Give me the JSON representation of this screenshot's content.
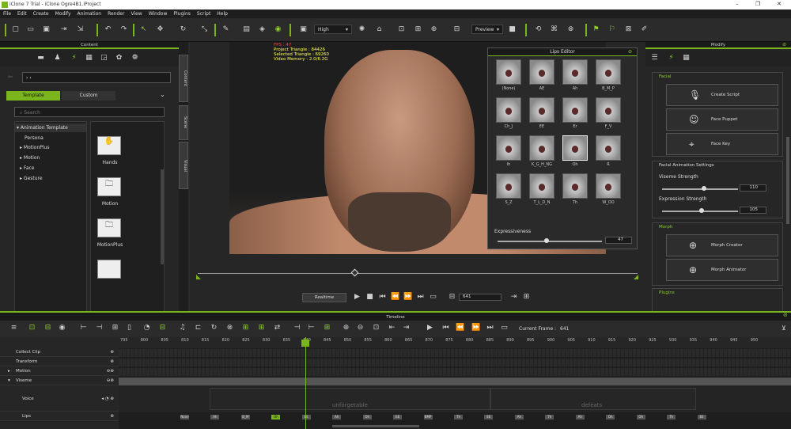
{
  "window": {
    "title": "iClone 7 Trial - iClone Ogre4B1.iProject",
    "controls": [
      "–",
      "❐",
      "✕"
    ]
  },
  "menu": [
    "File",
    "Edit",
    "Create",
    "Modify",
    "Animation",
    "Render",
    "View",
    "Window",
    "Plugins",
    "Script",
    "Help"
  ],
  "toolbar": {
    "quality": "High",
    "view_mode": "Preview",
    "icons": [
      "select-icon",
      "open-icon",
      "save-icon",
      "export-icon",
      "export2-icon",
      "undo-icon",
      "redo-icon",
      "pointer-icon",
      "move-icon",
      "rotate-icon",
      "scale-icon",
      "brush-icon",
      "display-icon",
      "light-icon",
      "quality-icon",
      "sun-icon",
      "home-icon",
      "align-icon",
      "fit-icon",
      "snap-icon",
      "camera-icon",
      "ik-icon",
      "fk-icon",
      "link-icon",
      "motion-icon",
      "flag-icon",
      "flag2-icon",
      "picker-icon"
    ]
  },
  "content_panel": {
    "title": "Content",
    "tabs": [
      "Template",
      "Custom"
    ],
    "search_placeholder": "Search",
    "path": "› ›",
    "tree": [
      "▾ Animation Template",
      "Persona",
      "▸ MotionPlus",
      "▸ Motion",
      "▸ Face",
      "▸ Gesture"
    ],
    "items": [
      "Hands",
      "Motion",
      "MotionPlus",
      ""
    ],
    "side_tabs": [
      "Content",
      "Scene",
      "Visual"
    ]
  },
  "viewport": {
    "stats": [
      "FPS : 47",
      "Project Triangle : 84426",
      "Selected Triangle : 69260",
      "Video Memory : 2.0/6.2G"
    ]
  },
  "lips_editor": {
    "title": "Lips Editor",
    "visemes": [
      "(None)",
      "AE",
      "Ah",
      "B_M_P",
      "Ch_J",
      "EE",
      "Er",
      "F_V",
      "Ih",
      "K_G_H_NG",
      "Oh",
      "R",
      "S_Z",
      "T_L_D_N",
      "Th",
      "W_OO"
    ],
    "selected": "Oh",
    "expressiveness_label": "Expressiveness",
    "expressiveness": "47",
    "expressiveness_fraction": 0.47
  },
  "playback": {
    "mode": "Realtime",
    "frame": "641",
    "loop_icon": "loop-icon"
  },
  "modify_panel": {
    "title": "Modify",
    "facial_label": "Facial",
    "buttons": [
      "Create Script",
      "Face Puppet",
      "Face Key"
    ],
    "settings_label": "Facial Animation Settings",
    "viseme_strength_label": "Viseme Strength",
    "viseme_strength": "110",
    "viseme_strength_fraction": 0.55,
    "expression_strength_label": "Expression Strength",
    "expression_strength": "105",
    "expression_strength_fraction": 0.52,
    "morph_label": "Morph",
    "morph_buttons": [
      "Morph Creator",
      "Morph Animator"
    ],
    "plugins_label": "Plugins"
  },
  "timeline": {
    "title": "Timeline",
    "current_frame_label": "Current Frame :",
    "current_frame": "641",
    "rows": [
      "Collect Clip",
      "Transform",
      "Motion",
      "Viseme",
      "Voice",
      "Lips"
    ],
    "ticks": [
      "795",
      "800",
      "805",
      "810",
      "815",
      "820",
      "825",
      "830",
      "835",
      "840",
      "845",
      "850",
      "855",
      "860",
      "865",
      "870",
      "875",
      "880",
      "885",
      "890",
      "895",
      "900",
      "905",
      "910",
      "915",
      "920",
      "925",
      "930",
      "935",
      "940",
      "945",
      "950"
    ],
    "voice_words": [
      "unforgetable",
      "defeats"
    ],
    "lip_keys": [
      "None",
      "Ah",
      "B_M",
      "Oh",
      "EE",
      "Ah",
      "Oh",
      "EE",
      "BMP",
      "Th",
      "EE",
      "Ah",
      "Th",
      "Ah",
      "Oh",
      "Oh",
      "Th",
      "EE"
    ]
  }
}
